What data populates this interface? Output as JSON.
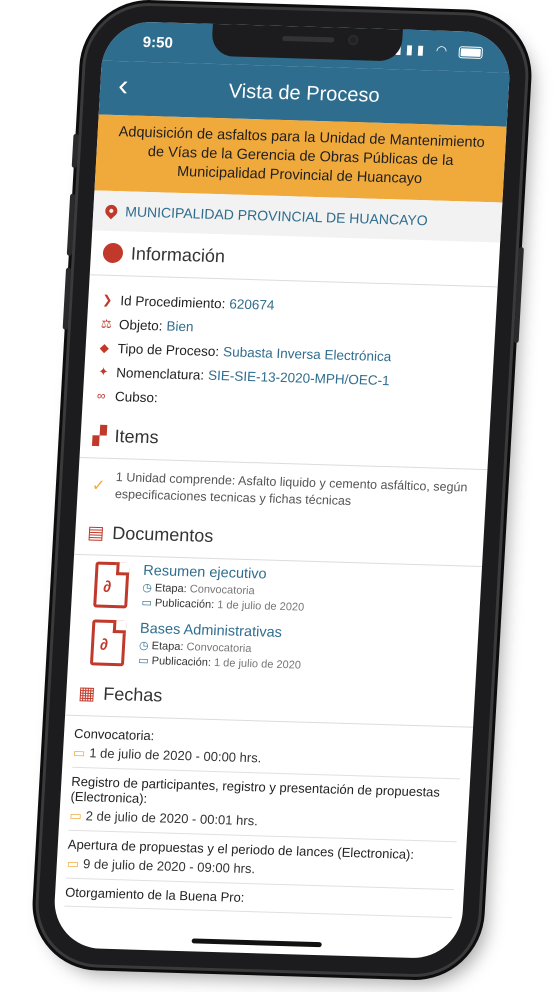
{
  "status": {
    "time": "9:50",
    "signal": "▮▮▮",
    "wifi": "◠"
  },
  "nav": {
    "back": "‹",
    "title": "Vista de Proceso"
  },
  "banner": {
    "text": "Adquisición de asfaltos para la Unidad de Mantenimiento de Vías de la Gerencia de Obras Públicas de la Municipalidad Provincial de Huancayo"
  },
  "entity": "MUNICIPALIDAD PROVINCIAL DE HUANCAYO",
  "info": {
    "heading": "Información",
    "rows": [
      {
        "label": "Id Procedimiento:",
        "value": "620674",
        "icon": "chevron-icon"
      },
      {
        "label": "Objeto:",
        "value": "Bien",
        "icon": "gavel-icon"
      },
      {
        "label": "Tipo de Proceso:",
        "value": "Subasta Inversa Electrónica",
        "icon": "tag-icon"
      },
      {
        "label": "Nomenclatura:",
        "value": "SIE-SIE-13-2020-MPH/OEC-1",
        "icon": "pin-icon"
      },
      {
        "label": "Cubso:",
        "value": "",
        "icon": "link-icon"
      }
    ]
  },
  "items": {
    "heading": "Items",
    "text": "1 Unidad comprende: Asfalto liquido y cemento asfáltico, según especificaciones tecnicas y fichas técnicas"
  },
  "documents": {
    "heading": "Documentos",
    "list": [
      {
        "title": "Resumen ejecutivo",
        "etapa_label": "Etapa:",
        "etapa": "Convocatoria",
        "pub_label": "Publicación:",
        "pub": "1 de julio de 2020"
      },
      {
        "title": "Bases Administrativas",
        "etapa_label": "Etapa:",
        "etapa": "Convocatoria",
        "pub_label": "Publicación:",
        "pub": "1 de julio de 2020"
      }
    ]
  },
  "dates": {
    "heading": "Fechas",
    "list": [
      {
        "label": "Convocatoria:",
        "date": "1 de julio de 2020 - 00:00 hrs."
      },
      {
        "label": "Registro de participantes, registro y presentación de propuestas (Electronica):",
        "date": "2 de julio de 2020 - 00:01 hrs."
      },
      {
        "label": "Apertura de propuestas y el periodo de lances (Electronica):",
        "date": "9 de julio de 2020 - 09:00 hrs."
      },
      {
        "label": "Otorgamiento de la Buena Pro:",
        "date": ""
      }
    ]
  },
  "colors": {
    "primary": "#2f6d8e",
    "accent": "#f0a93b",
    "icon_red": "#c0392b"
  }
}
